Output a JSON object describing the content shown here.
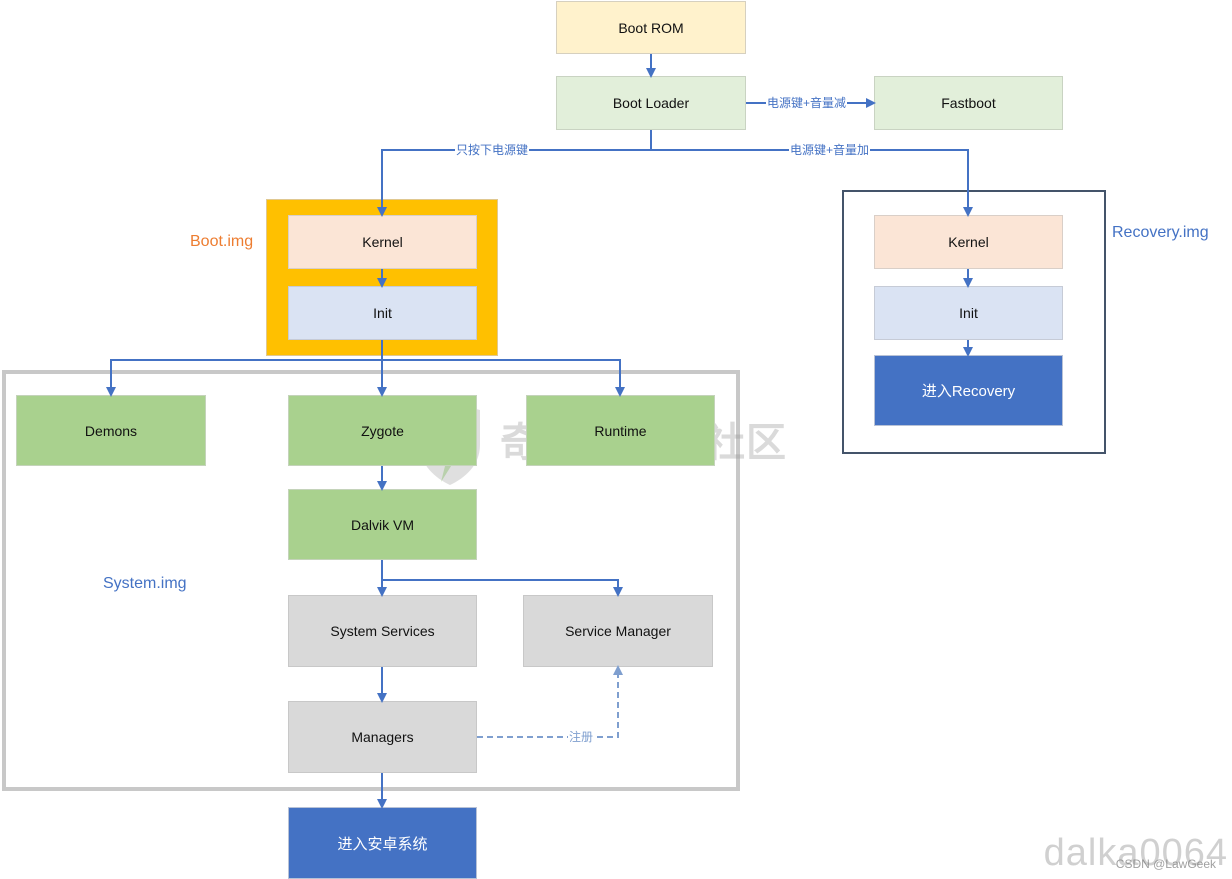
{
  "colors": {
    "arrow": "#4472c4",
    "arrow_dashed": "#7f9fcf",
    "boot_frame": "#ffc000",
    "system_frame": "#c8c8c8",
    "recovery_frame": "#44546a",
    "boot_label": "#ed7d31",
    "system_label": "#4472c4",
    "recovery_label": "#4472c4"
  },
  "nodes": {
    "boot_rom": "Boot ROM",
    "boot_loader": "Boot Loader",
    "fastboot": "Fastboot",
    "boot_kernel": "Kernel",
    "boot_init": "Init",
    "recovery_kernel": "Kernel",
    "recovery_init": "Init",
    "enter_recovery": "进入Recovery",
    "demons": "Demons",
    "zygote": "Zygote",
    "runtime": "Runtime",
    "dalvik_vm": "Dalvik VM",
    "system_services": "System Services",
    "service_manager": "Service Manager",
    "managers": "Managers",
    "enter_android": "进入安卓系统"
  },
  "frames": {
    "boot_img": "Boot.img",
    "system_img": "System.img",
    "recovery_img": "Recovery.img"
  },
  "edge_labels": {
    "power_vol_down": "电源键+音量减",
    "power_only": "只按下电源键",
    "power_vol_up": "电源键+音量加",
    "register": "注册"
  },
  "watermarks": {
    "community": "奇安信攻防社区",
    "author_big": "dalka0064",
    "author_small": "CSDN @LawGeek"
  }
}
